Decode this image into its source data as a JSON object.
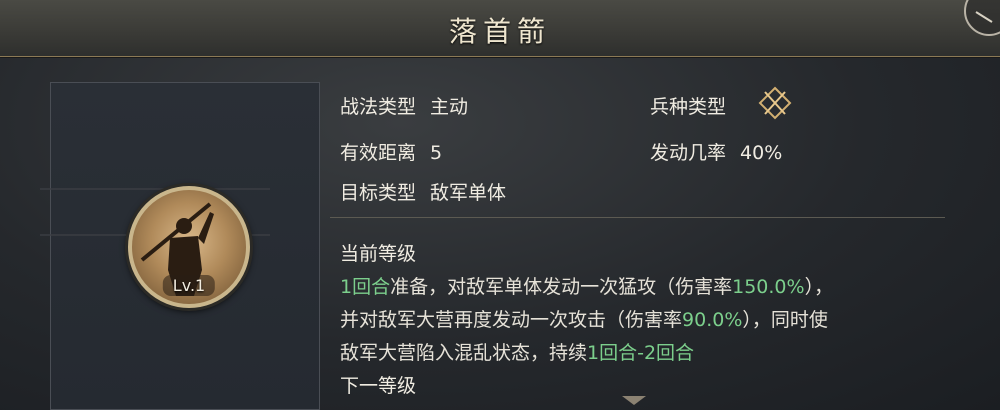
{
  "skill": {
    "title": "落首箭",
    "level_label": "Lv.1"
  },
  "attributes": {
    "tactic_type_label": "战法类型",
    "tactic_type_value": "主动",
    "troop_type_label": "兵种类型",
    "troop_type_icon": "crossed-arrows-icon",
    "range_label": "有效距离",
    "range_value": "5",
    "trigger_rate_label": "发动几率",
    "trigger_rate_value": "40%",
    "target_label": "目标类型",
    "target_value": "敌军单体"
  },
  "description": {
    "current_level_header": "当前等级",
    "line1_a": "1回合",
    "line1_b": "准备，对敌军单体发动一次猛攻（伤害率",
    "line1_c": "150.0%",
    "line1_d": "），",
    "line2_a": "并对敌军大营再度发动一次攻击（伤害率",
    "line2_b": "90.0%",
    "line2_c": "），同时使",
    "line3_a": "敌军大营陷入混乱状态，持续",
    "line3_b": "1回合-2回合",
    "next_level_header": "下一等级"
  },
  "colors": {
    "highlight_green": "#7ccf8c",
    "frame_gold": "#c9b68c"
  }
}
